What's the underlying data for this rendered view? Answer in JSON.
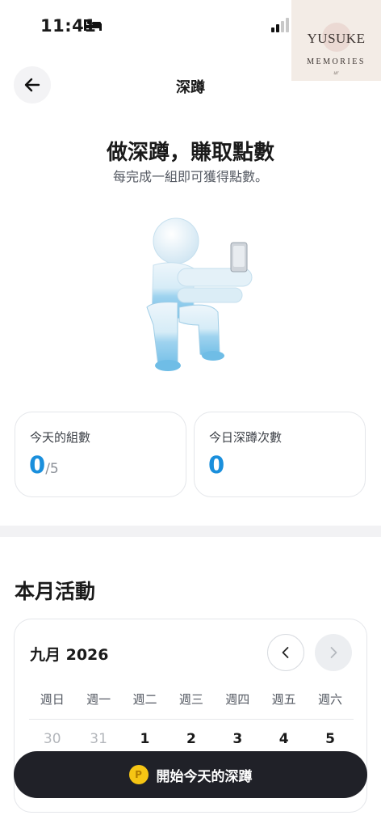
{
  "status_bar": {
    "time": "11:41"
  },
  "watermark": {
    "title": "YUSUKE",
    "subtitle": "MEMORIES",
    "signature": "ur"
  },
  "header": {
    "title": "深蹲"
  },
  "hero": {
    "title": "做深蹲，賺取點數",
    "subtitle": "每完成一組即可獲得點數。"
  },
  "stats": {
    "sets": {
      "label": "今天的組數",
      "value": "0",
      "denominator": "/5"
    },
    "squats": {
      "label": "今日深蹲次數",
      "value": "0"
    }
  },
  "section": {
    "title": "本月活動"
  },
  "calendar": {
    "month_label": "九月 2026",
    "weekdays": [
      "週日",
      "週一",
      "週二",
      "週三",
      "週四",
      "週五",
      "週六"
    ],
    "first_row": [
      "30",
      "31",
      "1",
      "2",
      "3",
      "4",
      "5"
    ]
  },
  "cta": {
    "label": "開始今天的深蹲",
    "coin_glyph": "P"
  },
  "colors": {
    "accent": "#1a8fdc",
    "cta_bg": "#202128",
    "coin": "#f6c514"
  },
  "icons": {
    "back": "arrow-left-icon",
    "prev": "chevron-left-icon",
    "next": "chevron-right-icon"
  }
}
